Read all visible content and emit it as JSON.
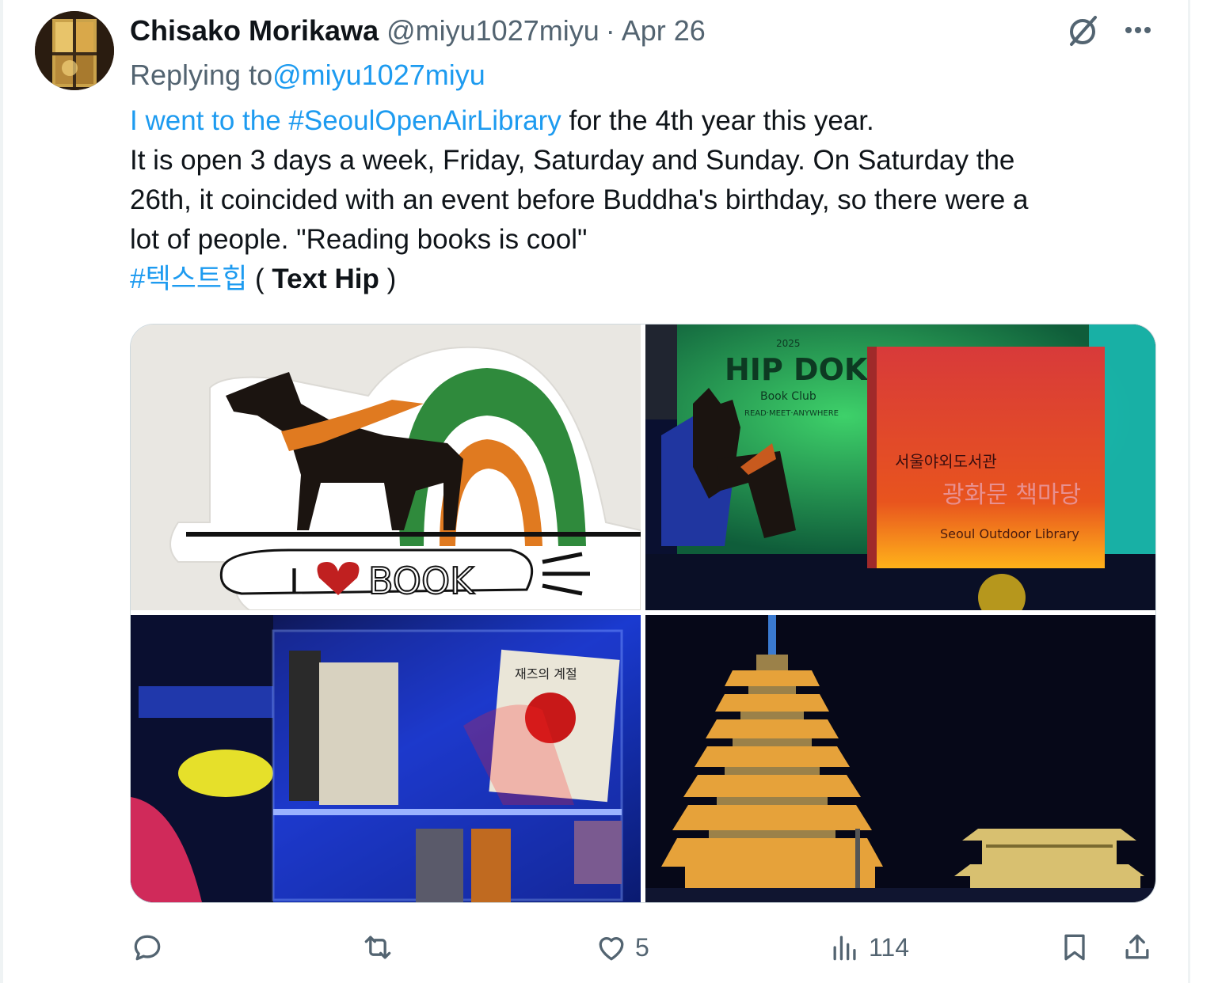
{
  "tweet": {
    "author_name": "Chisako Morikawa",
    "author_handle": "@miyu1027miyu",
    "separator": "·",
    "date": "Apr 26",
    "replying_prefix": "Replying to",
    "replying_handle": "@miyu1027miyu",
    "text": {
      "line1_link": "I went to the #SeoulOpenAirLibrary",
      "line1_rest": " for the 4th year this year.",
      "line2": " It is open 3 days a week, Friday, Saturday and Sunday. On Saturday the",
      "line3": "26th, it coincided with an event before Buddha's birthday, so there were a",
      "line4": "lot of people. \"Reading books is cool\"",
      "hashtag": " #텍스트힙",
      "paren_open": " ( ",
      "bold": "Text Hip",
      "paren_close": " )"
    }
  },
  "media": {
    "tile1": {
      "book_text": "BOOK",
      "i_text": "I"
    },
    "tile2": {
      "sign_title": "HIP DOK",
      "sign_sub": "Book Club",
      "sign_year": "2025",
      "sign_tagline": "READ·MEET·ANYWHERE",
      "book_korean1": "서울야외도서관",
      "book_korean2": "광화문 책마당",
      "book_english": "Seoul Outdoor Library"
    },
    "tile3": {
      "book_title": "재즈의 계절"
    }
  },
  "actions": {
    "reply": {
      "icon": "reply-icon",
      "count": ""
    },
    "retweet": {
      "icon": "retweet-icon",
      "count": ""
    },
    "like": {
      "icon": "heart-icon",
      "count": "5"
    },
    "views": {
      "icon": "views-icon",
      "count": "114"
    },
    "bookmark": {
      "icon": "bookmark-icon"
    },
    "share": {
      "icon": "share-icon"
    }
  },
  "colors": {
    "link": "#1d9bf0",
    "muted": "#536471",
    "text": "#0f1419",
    "border": "#cfd9de"
  }
}
